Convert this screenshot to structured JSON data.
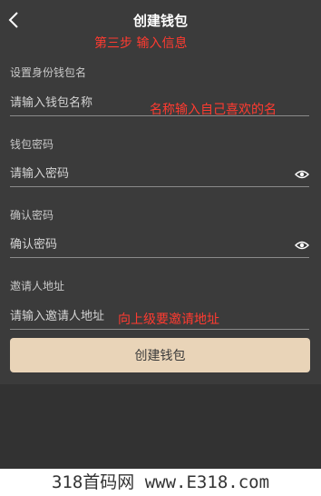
{
  "header": {
    "title": "创建钱包",
    "back_icon": "chevron-left-icon"
  },
  "annotations": {
    "step": "第三步  输入信息",
    "name_hint": "名称输入自己喜欢的名",
    "invite_hint": "向上级要邀请地址"
  },
  "form": {
    "wallet_name": {
      "label": "设置身份钱包名",
      "placeholder": "请输入钱包名称",
      "value": ""
    },
    "password": {
      "label": "钱包密码",
      "placeholder": "请输入密码",
      "value": "",
      "icon": "eye-icon"
    },
    "confirm_password": {
      "label": "确认密码",
      "placeholder": "确认密码",
      "value": "",
      "icon": "eye-icon"
    },
    "inviter": {
      "label": "邀请人地址",
      "placeholder": "请输入邀请人地址",
      "value": ""
    },
    "submit_label": "创建钱包"
  },
  "colors": {
    "background": "#323232",
    "panel": "#3b3b3b",
    "button": "#e9d4b8",
    "annotation": "#ff3b30"
  },
  "watermark": "318首码网 www.E318.com"
}
